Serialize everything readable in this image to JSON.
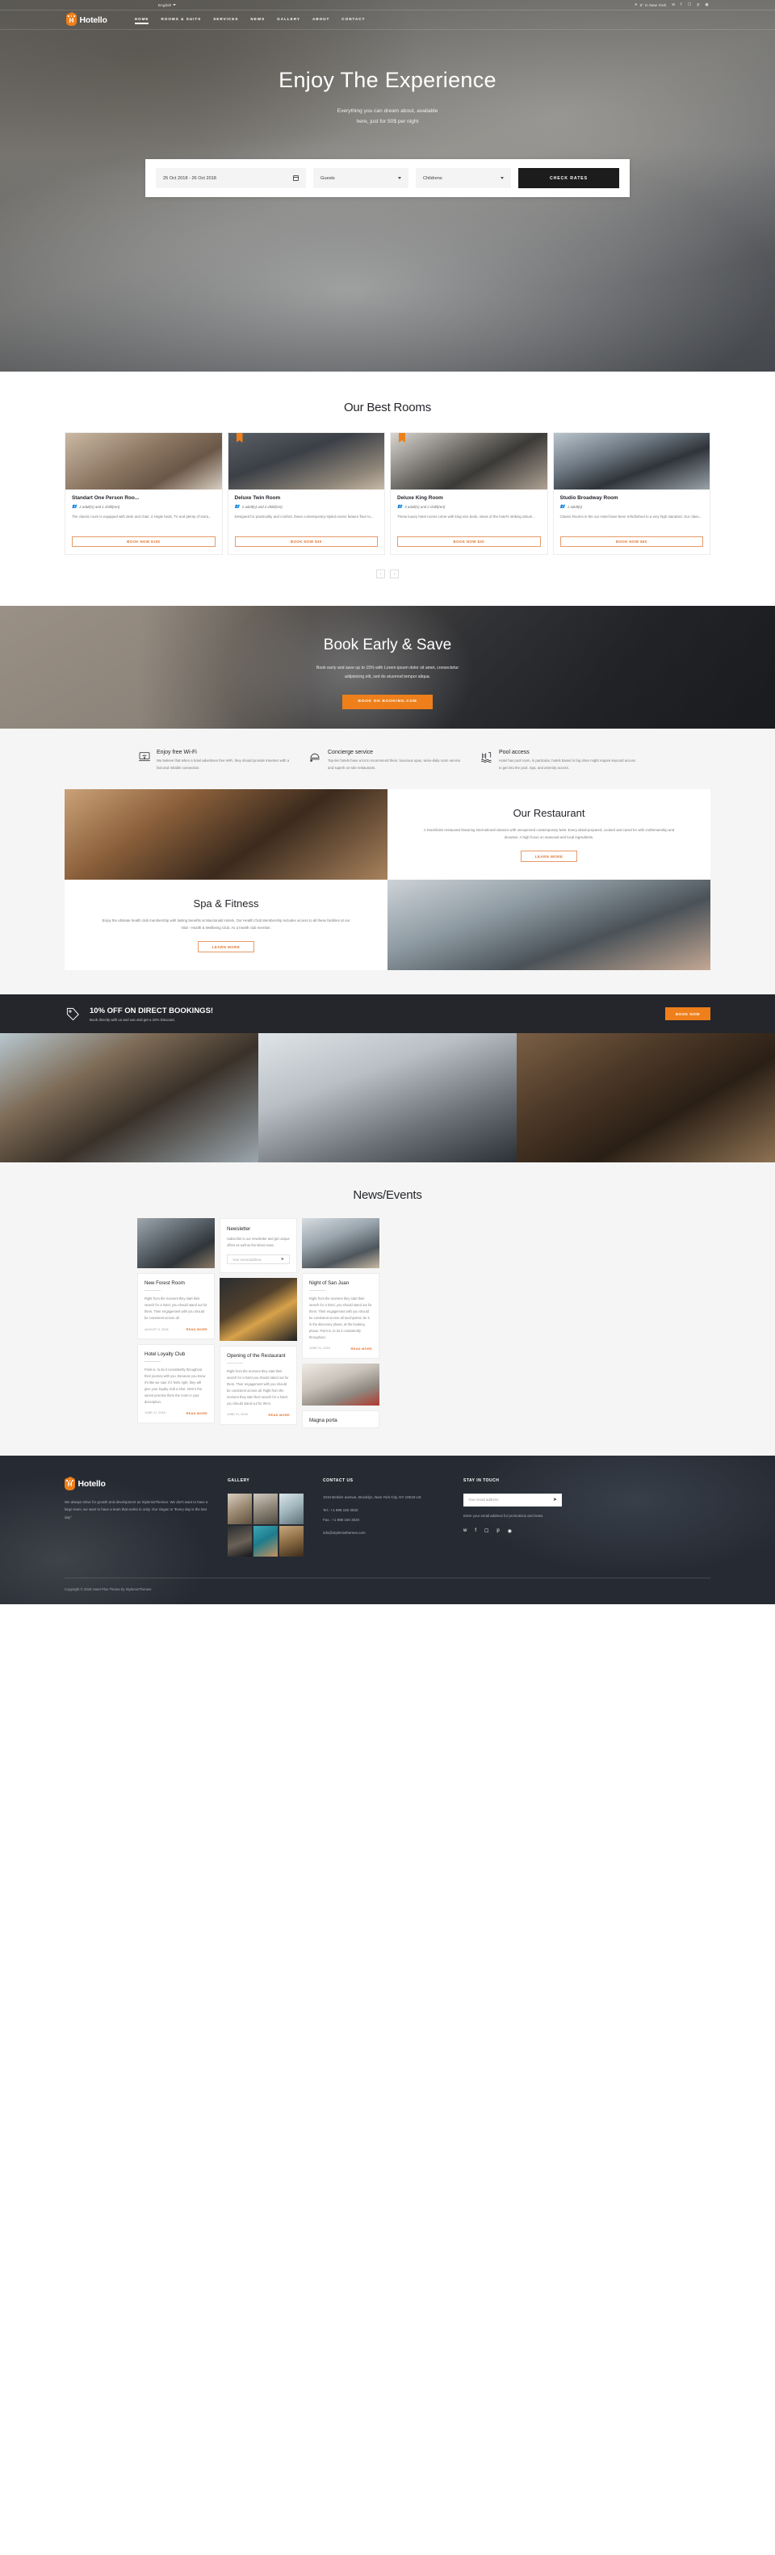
{
  "topbar": {
    "language": "English",
    "weather": "5° in New York",
    "socials": [
      "twitter-icon",
      "facebook-icon",
      "instagram-icon",
      "pinterest-icon",
      "tripadvisor-icon"
    ]
  },
  "brand": {
    "name": "Hotello"
  },
  "nav": {
    "items": [
      {
        "label": "HOME",
        "active": true
      },
      {
        "label": "ROOMS & SUITS",
        "active": false
      },
      {
        "label": "SERVICES",
        "active": false
      },
      {
        "label": "NEWS",
        "active": false
      },
      {
        "label": "GALLERY",
        "active": false
      },
      {
        "label": "ABOUT",
        "active": false
      },
      {
        "label": "CONTACT",
        "active": false
      }
    ]
  },
  "hero": {
    "title": "Enjoy The Experience",
    "subtitle_line1": "Everything you can dream about, available",
    "subtitle_line2": "here, just for 50$ per night"
  },
  "booking": {
    "dates": "25 Oct 2018 - 26 Oct 2018",
    "guests": "Guests",
    "children": "Childrens",
    "submit": "CHECK RATES"
  },
  "rooms": {
    "title": "Our Best Rooms",
    "prev": "‹",
    "next": "›",
    "cards": [
      {
        "name": "Standart One Person Roo...",
        "capacity": "2 adult(s) and 1 child(ren)",
        "desc": "The classic room is equipped with desk and chair, 2 single beds, TV and plenty of stora...",
        "button": "BOOK NOW $100"
      },
      {
        "name": "Deluxe Twin Room",
        "capacity": "2 adult(s) and 2 child(ren)",
        "desc": "Designed for practicality and comfort, these contemporary-styled rooms feature floor to...",
        "button": "BOOK NOW $30"
      },
      {
        "name": "Deluxe King Room",
        "capacity": "3 adult(s) and 2 child(ren)",
        "desc": "These luxury hotel rooms come with king size beds, views of the hotel's striking atrium...",
        "button": "BOOK NOW $30"
      },
      {
        "name": "Studio Broadway Room",
        "capacity": "1 adult(s)",
        "desc": "Classic Rooms in the our Hotel have been refurbished to a very high standard. Our class...",
        "button": "BOOK NOW $50"
      }
    ]
  },
  "early": {
    "title": "Book Early & Save",
    "sub_line1": "Book early and save up to 15% with Lorem ipsum dolor sit amet, consectetur",
    "sub_line2": "adipisicing elit, sed do eiusmod tempor aliqua.",
    "button": "BOOK ON BOOKING.COM"
  },
  "features": [
    {
      "icon": "wifi-icon",
      "title": "Enjoy free Wi-Fi",
      "text": "We believe that when a hotel advertises free WiFi, they should provide travelers with a fast and reliable connection."
    },
    {
      "icon": "room-service-icon",
      "title": "Concierge service",
      "text": "Top-tier hotels have a lot to recommend them: luxurious spas, twice-daily room service and superb on-site restaurants."
    },
    {
      "icon": "pool-icon",
      "title": "Pool access",
      "text": "Hotel has pool room, in particular, hotels based in big cities might require keycard access to get into the pool. Spa, and amenity access."
    }
  ],
  "restaurant": {
    "title": "Our Restaurant",
    "text": "A Stockholm restaurant featuring international classics with unexpected contemporary twist. Every detail prepared, cooked and cared for with craftsmanship and devotion. A high focus on seasonal and local ingredients.",
    "button": "LEARN MORE"
  },
  "spa": {
    "title": "Spa & Fitness",
    "text": "Enjoy the ultimate health club membership with lasting benefits at Macdonald Hotels. Our Health Club Membership includes access to all these facilities at our Vital - Health & Wellbeing Club. As a health club member.",
    "button": "LEARN MORE"
  },
  "promo": {
    "icon": "price-tag-icon",
    "title": "10% OFF ON DIRECT BOOKINGS!",
    "subtitle": "Book directly with us and use and get a 10% Discount.",
    "button": "BOOK NOW"
  },
  "news": {
    "title": "News/Events",
    "items": [
      {
        "title": "New Forest Room",
        "text": "Right from the moment they start their search for a hotel, you should stand out for them. Their engagement with you should be consistent across all.",
        "date": "AUGUST 3, 2018",
        "more": "READ MORE"
      },
      {
        "title": "Night of San Juan",
        "text": "Right from the moment they start their search for a hotel, you should stand out for them. Their engagement with you should be consistent across all touchpoints: be it in the discovery phase, at the booking phase. Point is, to do it consistently throughout.",
        "date": "JUNE 21, 2018",
        "more": "READ MORE"
      },
      {
        "title": "Hotel Loyalty Club",
        "text": "Point is, to do it consistently throughout their journey with you. Because you know it's like we saw: if it feels right, they will give your loyalty club a shot. Here's the surest promise them the room in your description.",
        "date": "JUNE 21, 2018",
        "more": "READ MORE"
      },
      {
        "title": "Opening of the Restaurant",
        "text": "Right from the moment they start their search for a hotel you should stand out for them. Their engagement with you should be consistent across all. Right from the moment they start their search for a hotel, you should stand out for them.",
        "date": "JUNE 21, 2018",
        "more": "READ MORE"
      },
      {
        "title": "Magna porta",
        "text": "",
        "date": "",
        "more": ""
      }
    ],
    "newsletter": {
      "title": "Newsletter",
      "text": "Subscribe to our newsletter and get unique offers as well as the latest news.",
      "placeholder": "Your email address",
      "submit": "➤"
    }
  },
  "footer": {
    "brand": "Hotello",
    "about": "We always strive for growth and development as StylemixThemes. We don't want to have a large team, we want to have a team that works in unity. Our slogan is “Every day is the last day”.",
    "gallery_heading": "GALLERY",
    "contact_heading": "CONTACT US",
    "address": "1010 Berkler avenue, Brooklyn, New York City, NY 10018 US",
    "tel": "Tel.: +1 998 150 3020",
    "fax": "Fax.: +1 998 150 3020",
    "email": "info@stylemixthemes.com",
    "touch_heading": "STAY IN TOUCH",
    "email_placeholder": "Your email address",
    "email_submit": "➤",
    "email_hint": "Enter your email address for promotions and news.",
    "socials": [
      "twitter-icon",
      "facebook-icon",
      "instagram-icon",
      "pinterest-icon",
      "tripadvisor-icon"
    ],
    "copyright": "Copyright © 2018 Hotel Plus Theme by StylemixThemes"
  },
  "colors": {
    "accent": "#ef7f1a",
    "dark": "#24262b",
    "footer": "#262b33"
  }
}
